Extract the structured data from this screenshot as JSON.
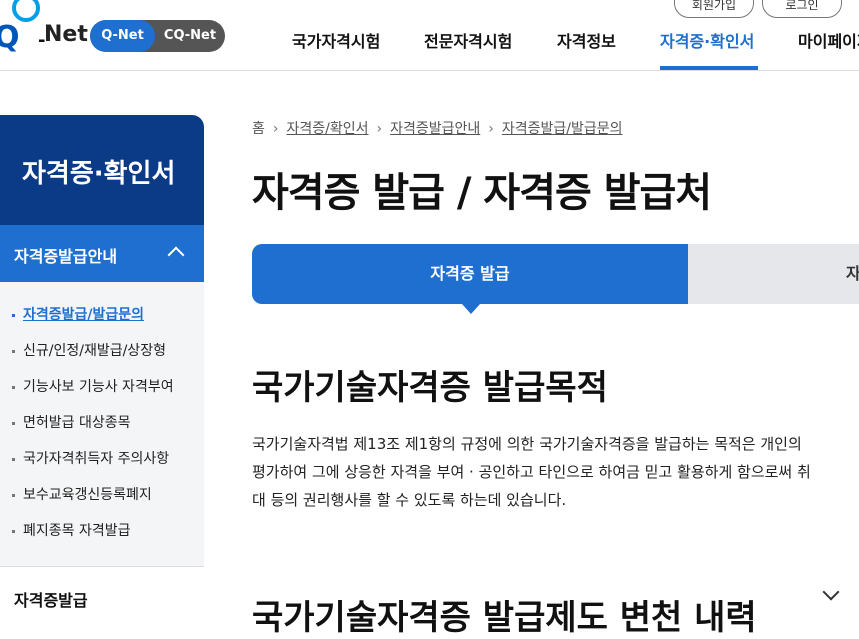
{
  "header": {
    "logo_text": "Q-Net",
    "logo_q": "Q",
    "logo_net": "Net",
    "pill": {
      "qnet": "Q-Net",
      "cqnet": "CQ-Net"
    },
    "util": {
      "join": "회원가입",
      "login": "로그인"
    },
    "gnb": [
      "국가자격시험",
      "전문자격시험",
      "자격정보",
      "자격증·확인서",
      "마이페이지"
    ]
  },
  "sidebar": {
    "title": "자격증·확인서",
    "group1": "자격증발급안내",
    "items": [
      "자격증발급/발급문의",
      "신규/인정/재발급/상장형",
      "기능사보 기능사 자격부여",
      "면허발급 대상종목",
      "국가자격취득자 주의사항",
      "보수교육갱신등록폐지",
      "폐지종목 자격발급"
    ],
    "group2": "자격증발급"
  },
  "breadcrumb": [
    "홈",
    "자격증/확인서",
    "자격증발급안내",
    "자격증발급/발급문의"
  ],
  "page_title": "자격증 발급 / 자격증 발급처",
  "tabs": {
    "active": "자격증 발급",
    "inactive": "자"
  },
  "section": {
    "title": "국가기술자격증 발급목적",
    "lines": [
      "국가기술자격법 제13조 제1항의 규정에 의한 국가기술자격증을 발급하는 목적은 개인의",
      "평가하여 그에 상응한 자격을 부여 · 공인하고 타인으로 하여금 믿고 활용하게 함으로써 취",
      "대 등의 권리행사를 할 수 있도록 하는데 있습니다."
    ],
    "title2": "국가기술자격증 발급제도 변천 내력"
  },
  "colors": {
    "primary": "#1f6fd0",
    "sidebar_dark": "#0b3b86",
    "accent_light": "#00a0e9"
  }
}
